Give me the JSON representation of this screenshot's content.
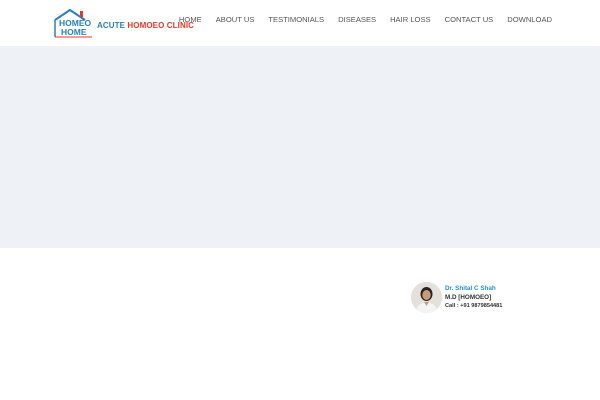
{
  "header": {
    "logo": {
      "mark_top": "HOMEO",
      "mark_bottom": "HOME",
      "name_part1": "ACUTE",
      "name_part2": "HOMOEO CLINIC",
      "colors": {
        "blue": "#2a7fc1",
        "red": "#e8392b"
      }
    },
    "nav": [
      {
        "label": "HOME"
      },
      {
        "label": "ABOUT US"
      },
      {
        "label": "TESTIMONIALS"
      },
      {
        "label": "DISEASES"
      },
      {
        "label": "HAIR LOSS"
      },
      {
        "label": "CONTACT US"
      },
      {
        "label": "DOWNLOAD"
      }
    ]
  },
  "banner": {
    "color": "#eef1f6"
  },
  "doctor": {
    "name": "Dr. Shital C Shah",
    "degree": "M.D [HOMOEO]",
    "call": "Call : +91 9879854481",
    "name_color": "#2a8fd0"
  }
}
